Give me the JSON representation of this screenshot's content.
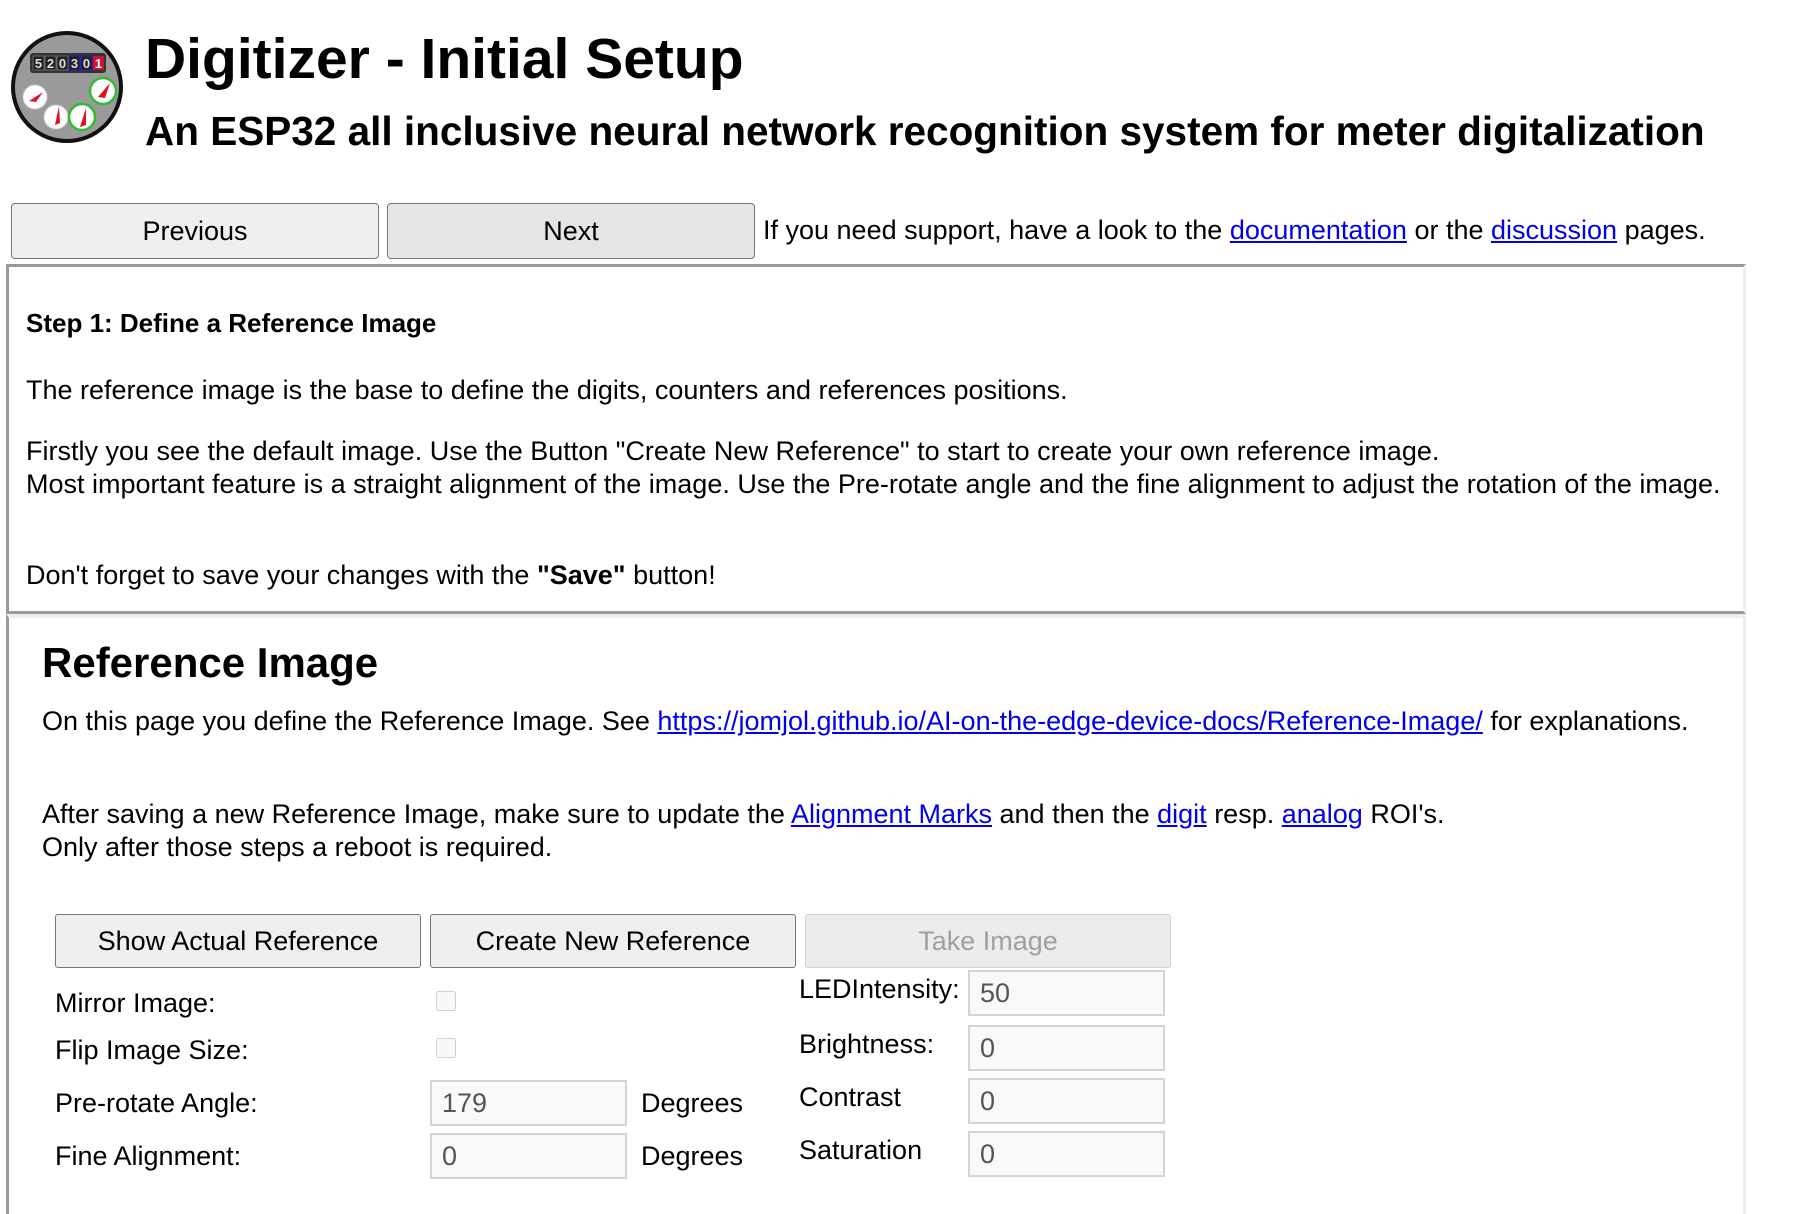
{
  "header": {
    "logo_icon": "water-meter-logo-icon",
    "logo_counter_digits": [
      "5",
      "2",
      "0",
      "3",
      "0",
      "1"
    ],
    "title": "Digitizer - Initial Setup",
    "subtitle": "An ESP32 all inclusive neural network recognition system for meter digitalization"
  },
  "nav": {
    "previous_label": "Previous",
    "next_label": "Next",
    "support_text_before": "If you need support, have a look to the ",
    "documentation_link": "documentation",
    "support_text_middle": " or the ",
    "discussion_link": "discussion",
    "support_text_after": " pages."
  },
  "step": {
    "title": "Step 1: Define a Reference Image",
    "p1": "The reference image is the base to define the digits, counters and references positions.",
    "p2_line1": "Firstly you see the default image. Use the Button \"Create New Reference\" to start to create your own reference image.",
    "p2_line2": "Most important feature is a straight alignment of the image. Use the Pre-rotate angle and the fine alignment to adjust the rotation of the image.",
    "p3_before": "Don't forget to save your changes with the ",
    "p3_bold": "\"Save\"",
    "p3_after": " button!"
  },
  "reference": {
    "title": "Reference Image",
    "p1_before": "On this page you define the Reference Image. See ",
    "p1_link": "https://jomjol.github.io/AI-on-the-edge-device-docs/Reference-Image/",
    "p1_after": " for explanations.",
    "p2_before": "After saving a new Reference Image, make sure to update the ",
    "p2_link_alignment": "Alignment Marks",
    "p2_mid1": " and then the ",
    "p2_link_digit": "digit",
    "p2_mid2": " resp. ",
    "p2_link_analog": "analog",
    "p2_after": " ROI's.",
    "p2_line2": "Only after those steps a reboot is required."
  },
  "actions": {
    "show_actual_reference": "Show Actual Reference",
    "create_new_reference": "Create New Reference",
    "take_image": "Take Image"
  },
  "form": {
    "mirror_label": "Mirror Image:",
    "mirror_checked": false,
    "flip_label": "Flip Image Size:",
    "flip_checked": false,
    "prerotate_label": "Pre-rotate Angle:",
    "prerotate_value": "179",
    "prerotate_unit": "Degrees",
    "fine_label": "Fine Alignment:",
    "fine_value": "0",
    "fine_unit": "Degrees",
    "led_label": "LEDIntensity:",
    "led_value": "50",
    "brightness_label": "Brightness:",
    "brightness_value": "0",
    "contrast_label": "Contrast",
    "contrast_value": "0",
    "saturation_label": "Saturation",
    "saturation_value": "0"
  },
  "colors": {
    "link": "#0000ee",
    "border": "#999999",
    "button_bg": "#efefef",
    "disabled_text": "#a0a0a0"
  }
}
